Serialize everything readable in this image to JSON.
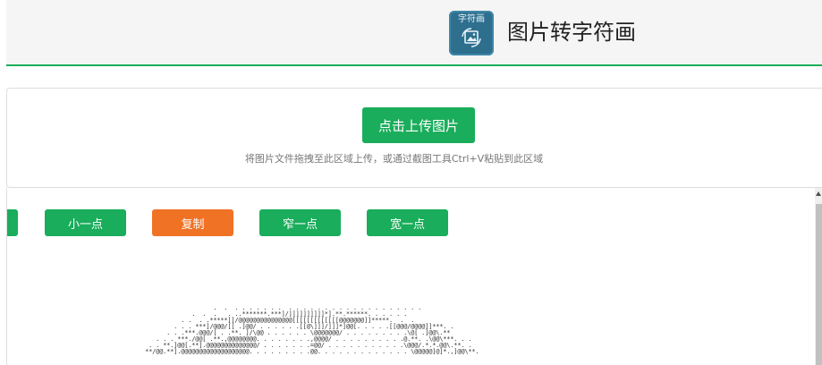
{
  "header": {
    "logo_text": "字符画",
    "title": "图片转字符画"
  },
  "upload": {
    "button_label": "点击上传图片",
    "hint": "将图片文件拖拽至此区域上传，或通过截图工具Ctrl+V粘贴到此区域"
  },
  "controls": {
    "smaller_label": "小一点",
    "copy_label": "复制",
    "narrower_label": "窄一点",
    "wider_label": "宽一点"
  },
  "colors": {
    "accent": "#1aad5b",
    "copy": "#f07225"
  },
  "ascii_art": "                        .  .  . . . . . . .  . . . . . . . . . . . . . . . . . . .\n                  .  .  .   . ..*******.***]/]]]]]]]]]]*].**.******. . . . . .\n               . .  . .*****]]/@@@@@@@@@@@@@@@[[[[[[[[[[[[[@@@@@@@]]*****.  .  .\n             . . . ***]/@@@/[[ .]@@/ . . . . . .[[@\\]]]/]]]*]@@[. . . . .[[@@@/@@@@]]***. .\n           . . .***.@@@/[ . .**. ]/\\@@ . . . . . . \\@@@@@@@/ . . . . . . . . .\\@[ .]@@\\.**\n        . . . ***./@@[ .**.,@@@@@@@@. . . . . . . .,@@@@/ . . . . . . . . . .@.**. .\\@@\\***. . .\n      . . **.]@@[.**].@@@@@@@@@@@@@@/ . . . . . . .=@@/ . . . . . . . . . . .\\@@@/.*.*.@@\\.**. .\n     **/@@.**].@@@@@@@@@@@@@@@@@@@. . . . . . . . .@@. . . . . . . . . . . . . \\@@@@@]@]*.,]@@\\**."
}
